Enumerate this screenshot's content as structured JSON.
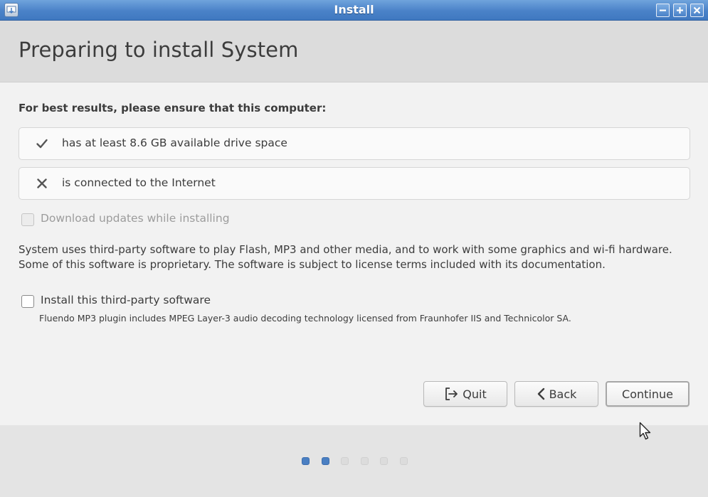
{
  "window": {
    "title": "Install"
  },
  "header": {
    "title": "Preparing to install System"
  },
  "main": {
    "intro": "For best results, please ensure that this computer:",
    "requirements": [
      {
        "icon": "checkmark-icon",
        "status": "met",
        "text": "has at least 8.6 GB available drive space"
      },
      {
        "icon": "cross-icon",
        "status": "unmet",
        "text": "is connected to the Internet"
      }
    ],
    "download_updates": {
      "label": "Download updates while installing",
      "checked": false,
      "disabled": true
    },
    "third_party_description": "System uses third-party software to play Flash, MP3 and other media, and to work with some graphics and wi-fi hardware. Some of this software is proprietary. The software is subject to license terms included with its documentation.",
    "third_party": {
      "label": "Install this third-party software",
      "checked": false
    },
    "plugin_note": "Fluendo MP3 plugin includes MPEG Layer-3 audio decoding technology licensed from Fraunhofer IIS and Technicolor SA."
  },
  "buttons": {
    "quit": "Quit",
    "back": "Back",
    "continue": "Continue"
  },
  "progress": {
    "total_steps": 6,
    "current_step": 2
  },
  "colors": {
    "titlebar": "#4a82c8",
    "accent": "#4a7fc2",
    "text": "#3c3c3c"
  }
}
